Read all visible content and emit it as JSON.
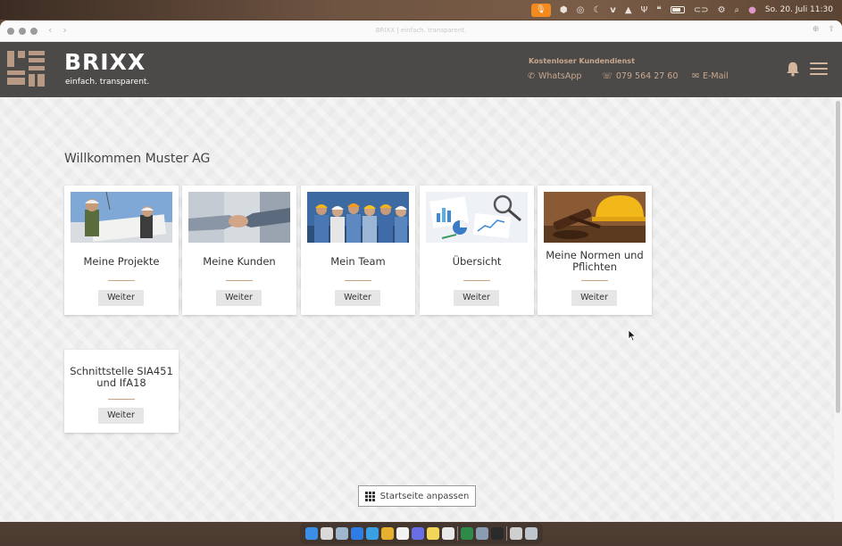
{
  "menubar": {
    "apple": "",
    "clock": "So. 20. Juli  11:30",
    "icons": [
      "mic-icon",
      "box-icon",
      "target-icon",
      "moon-icon",
      "vivaldi-icon",
      "triangle-icon",
      "fork-icon",
      "quote-icon",
      "battery-icon",
      "link-icon",
      "control-center-icon",
      "search-icon",
      "siri-icon"
    ]
  },
  "browser": {
    "url": "BRIXX | einfach. transparent."
  },
  "header": {
    "brand": "BRIXX",
    "tagline": "einfach. transparent.",
    "support_title": "Kostenloser Kundendienst",
    "whatsapp": "WhatsApp",
    "phone": "079 564 27 60",
    "email": "E-Mail",
    "colors": {
      "bg": "#4b4a48",
      "accent": "#c9a88f"
    }
  },
  "main": {
    "welcome": "Willkommen Muster AG",
    "cards": [
      {
        "title": "Meine Projekte",
        "button": "Weiter",
        "image": "construction-workers-plans"
      },
      {
        "title": "Meine Kunden",
        "button": "Weiter",
        "image": "handshake"
      },
      {
        "title": "Mein Team",
        "button": "Weiter",
        "image": "team-hardhats"
      },
      {
        "title": "Übersicht",
        "button": "Weiter",
        "image": "charts-magnifier"
      },
      {
        "title": "Meine Normen und Pflichten",
        "button": "Weiter",
        "image": "gavel-helmet"
      },
      {
        "title": "Schnittstelle SIA451 und IfA18",
        "button": "Weiter",
        "image": ""
      }
    ],
    "customize_label": "Startseite anpassen"
  }
}
